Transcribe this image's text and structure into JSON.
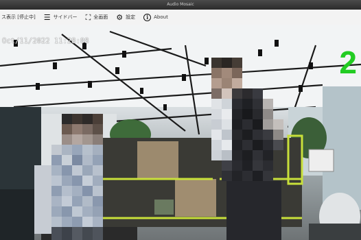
{
  "window": {
    "title": "Audio Mosaic"
  },
  "toolbar": {
    "status_label": "ス表示 [停止中]",
    "sidebar_label": "サイドバー",
    "fullscreen_label": "全画面",
    "settings_label": "設定",
    "about_label": "About"
  },
  "video": {
    "timestamp": "Oct/11/2022 11:28:08",
    "camera_number": "2"
  },
  "colors": {
    "camera_number": "#22cc22",
    "toolbar_bg": "#f3f3f3",
    "titlebar_bg": "#2b2b2b"
  }
}
